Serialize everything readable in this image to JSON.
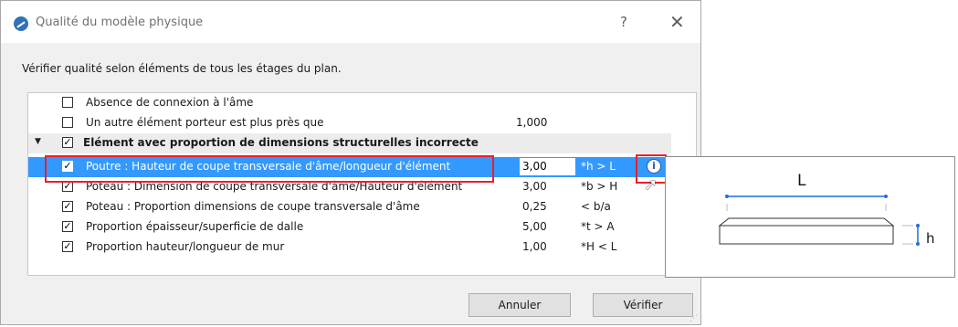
{
  "window": {
    "title": "Qualité du modèle physique",
    "help_glyph": "?",
    "close_glyph": "✕"
  },
  "instruction": "Vérifier qualité selon éléments de tous les étages du plan.",
  "rows": [
    {
      "label": "Absence de connexion à l'âme",
      "checked": false,
      "value": "",
      "condition": ""
    },
    {
      "label": "Un autre élément porteur est plus près que",
      "checked": false,
      "value": "1,000",
      "condition": ""
    },
    {
      "label": "Elément avec proportion de dimensions structurelles incorrecte",
      "checked": true,
      "value": "",
      "condition": "",
      "group": true,
      "expanded": true
    },
    {
      "label": "Poutre : Hauteur de coupe transversale d'âme/longueur d'élément",
      "checked": true,
      "value": "3,00",
      "condition": "*h > L",
      "selected": true
    },
    {
      "label": "Poteau : Dimension de coupe transversale d'âme/Hauteur d'élément",
      "checked": true,
      "value": "3,00",
      "condition": "*b > H"
    },
    {
      "label": "Poteau : Proportion dimensions de coupe transversale d'âme",
      "checked": true,
      "value": "0,25",
      "condition": "< b/a"
    },
    {
      "label": "Proportion épaisseur/superficie de dalle",
      "checked": true,
      "value": "5,00",
      "condition": "*t > A"
    },
    {
      "label": "Proportion hauteur/longueur de mur",
      "checked": true,
      "value": "1,00",
      "condition": "*H < L"
    }
  ],
  "buttons": {
    "cancel": "Annuler",
    "verify": "Vérifier"
  },
  "diagram": {
    "length_label": "L",
    "height_label": "h"
  },
  "icons": {
    "info": "info-icon",
    "check": "✓",
    "expand": "▼",
    "scroll_up": "^",
    "cursor": "pointer-cursor"
  },
  "colors": {
    "selection": "#3399ff",
    "highlight": "#e8202a",
    "dimension_line": "#1e6fd9"
  }
}
